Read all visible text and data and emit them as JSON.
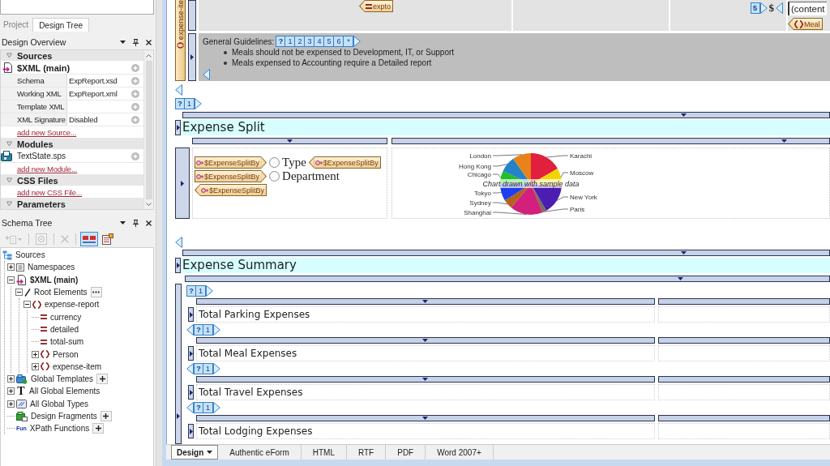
{
  "project_tabs": [
    {
      "label": "Project",
      "selected": false
    },
    {
      "label": "Design Tree",
      "selected": true
    }
  ],
  "design_overview": {
    "title": "Design Overview",
    "sections": [
      {
        "title": "Sources",
        "expanded": true,
        "items": [
          {
            "kind": "source",
            "label": "$XML (main)"
          },
          {
            "kind": "property",
            "label": "Schema",
            "value": "ExpReport.xsd"
          },
          {
            "kind": "property",
            "label": "Working XML",
            "value": "ExpReport.xml"
          },
          {
            "kind": "property",
            "label": "Template XML"
          },
          {
            "kind": "property",
            "label": "XML Signature",
            "value": "Disabled"
          },
          {
            "kind": "link",
            "label": "add new Source..."
          }
        ]
      },
      {
        "title": "Modules",
        "expanded": true,
        "items": [
          {
            "kind": "module",
            "label": "TextState.sps"
          },
          {
            "kind": "link",
            "label": "add new Module..."
          }
        ]
      },
      {
        "title": "CSS Files",
        "expanded": true,
        "items": [
          {
            "kind": "link",
            "label": "add new CSS File..."
          }
        ]
      },
      {
        "title": "Parameters",
        "expanded": true
      }
    ]
  },
  "schema_tree": {
    "title": "Schema Tree",
    "toolbar": [
      {
        "kind": "add",
        "disabled": true,
        "on": false
      },
      {
        "kind": "view",
        "disabled": true,
        "on": false
      },
      {
        "kind": "remove",
        "disabled": true,
        "on": false
      },
      {
        "kind": "toggle",
        "disabled": false,
        "on": true
      },
      {
        "kind": "table",
        "disabled": false,
        "on": false
      }
    ],
    "nodes": [
      {
        "kind": "sources",
        "label": "Sources",
        "children": [
          {
            "kind": "namespaces",
            "label": "Namespaces",
            "expanded": false
          },
          {
            "kind": "source",
            "label": "$XML (main)",
            "expanded": true,
            "children": [
              {
                "kind": "root",
                "label": "Root Elements",
                "expanded": true,
                "more_button": true,
                "children": [
                  {
                    "kind": "element",
                    "label": "expense-report",
                    "expanded": true,
                    "children": [
                      {
                        "kind": "attribute",
                        "label": "currency"
                      },
                      {
                        "kind": "attribute",
                        "label": "detailed"
                      },
                      {
                        "kind": "attribute",
                        "label": "total-sum"
                      },
                      {
                        "kind": "element",
                        "label": "Person",
                        "expanded": false
                      },
                      {
                        "kind": "element",
                        "label": "expense-item",
                        "expanded": false
                      }
                    ]
                  }
                ]
              }
            ]
          },
          {
            "kind": "templates",
            "label": "Global Templates",
            "expanded": false,
            "add_button": true
          },
          {
            "kind": "elements",
            "glyph": "T",
            "label": "All Global Elements",
            "expanded": false
          },
          {
            "kind": "types",
            "label": "All Global Types",
            "expanded": false
          },
          {
            "kind": "fragments",
            "label": "Design Fragments",
            "add_button": true
          },
          {
            "kind": "functions",
            "glyph": "Fun",
            "label": "XPath Functions",
            "add_button": true
          }
        ]
      }
    ]
  },
  "design": {
    "template": {
      "tag": "expense-ite",
      "cells": [
        {
          "items": [
            {
              "kind": "attribute-tag",
              "text": "expto"
            }
          ]
        },
        {},
        {
          "items": [
            {
              "kind": "predicate",
              "cells": [
                "5"
              ]
            },
            {
              "kind": "symbol",
              "text": "$"
            },
            {
              "kind": "end-marker"
            }
          ]
        },
        {
          "items": [
            {
              "kind": "content",
              "text": "(content"
            },
            {
              "kind": "element-tag",
              "text": "Meal"
            }
          ]
        }
      ],
      "guidelines": {
        "label": "General Guidelines:",
        "predicate": [
          "?",
          "1",
          "2",
          "3",
          "4",
          "5",
          "6",
          "*"
        ],
        "bullets": [
          "Meals should not be expensed to Development, IT, or Support",
          "Meals expensed to Accounting require a Detailed report"
        ]
      }
    },
    "split": {
      "predicate": [
        "?",
        "1"
      ],
      "heading": "Expense Split",
      "options": [
        {
          "start_tag": "$ExpenseSplitBy",
          "label": "Type",
          "selected": false,
          "end_tag": "$ExpenseSplitBy"
        },
        {
          "start_tag": "$ExpenseSplitBy",
          "label": "Department",
          "selected": false,
          "end_tag": "$ExpenseSplitBy"
        }
      ],
      "chart": {
        "caption": "Chart drawn with sample data",
        "slices": [
          {
            "label": "London",
            "color": "#e8821a"
          },
          {
            "label": "Hong Kong",
            "color": "#2383c9"
          },
          {
            "label": "Chicago",
            "color": "#22c022"
          },
          {
            "label": "Tokyo",
            "color": "#1c3ff0"
          },
          {
            "label": "Sydney",
            "color": "#b4621e"
          },
          {
            "label": "Shanghai",
            "color": "#d2207c"
          },
          {
            "label": "Karachi",
            "color": "#e0203c"
          },
          {
            "label": "Moscow",
            "color": "#f4d400"
          },
          {
            "label": "New York",
            "color": "#4b1db0"
          },
          {
            "label": "Paris",
            "color": "#7d6b5a"
          }
        ]
      }
    },
    "summary": {
      "heading": "Expense Summary",
      "rows": [
        {
          "predicate": [
            "?",
            "1"
          ],
          "label": "Total Parking Expenses"
        },
        {
          "predicate": [
            "?",
            "1"
          ],
          "label": "Total Meal Expenses"
        },
        {
          "predicate": [
            "?",
            "1"
          ],
          "label": "Total Travel Expenses"
        },
        {
          "predicate": [
            "?",
            "1"
          ],
          "label": "Total Lodging Expenses"
        }
      ]
    }
  },
  "view_tabs": [
    {
      "label": "Design",
      "selected": true,
      "menu": true
    },
    {
      "label": "Authentic eForm",
      "selected": false,
      "menu": false
    },
    {
      "label": "HTML",
      "selected": false,
      "menu": false
    },
    {
      "label": "RTF",
      "selected": false,
      "menu": false
    },
    {
      "label": "PDF",
      "selected": false,
      "menu": false
    },
    {
      "label": "Word 2007+",
      "selected": false,
      "menu": false
    }
  ]
}
